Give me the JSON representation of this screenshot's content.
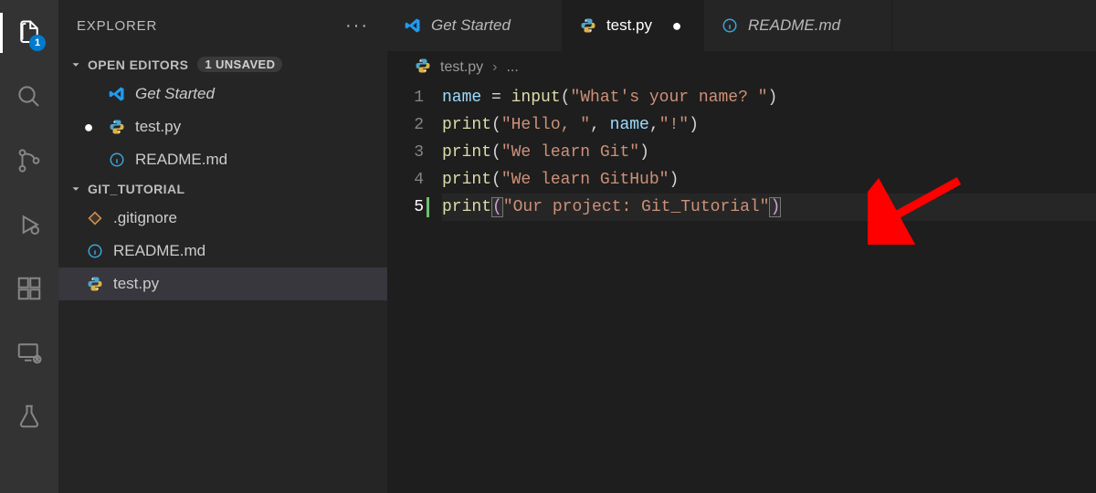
{
  "activity_bar": {
    "explorer_badge": "1"
  },
  "sidebar": {
    "title": "EXPLORER",
    "sections": {
      "open_editors": {
        "label": "OPEN EDITORS",
        "unsaved_label": "1 UNSAVED",
        "items": [
          {
            "label": "Get Started",
            "icon": "vscode",
            "italic": true,
            "modified": false
          },
          {
            "label": "test.py",
            "icon": "python",
            "italic": false,
            "modified": true
          },
          {
            "label": "README.md",
            "icon": "info",
            "italic": false,
            "modified": false
          }
        ]
      },
      "folder": {
        "label": "GIT_TUTORIAL",
        "items": [
          {
            "label": ".gitignore",
            "icon": "git",
            "selected": false
          },
          {
            "label": "README.md",
            "icon": "info",
            "selected": false
          },
          {
            "label": "test.py",
            "icon": "python",
            "selected": true
          }
        ]
      }
    }
  },
  "tabs": [
    {
      "label": "Get Started",
      "icon": "vscode",
      "active": false,
      "italic": true,
      "modified": false
    },
    {
      "label": "test.py",
      "icon": "python",
      "active": true,
      "italic": false,
      "modified": true
    },
    {
      "label": "README.md",
      "icon": "info",
      "active": false,
      "italic": false,
      "modified": false
    }
  ],
  "breadcrumb": {
    "file_icon": "python",
    "file": "test.py",
    "rest": "..."
  },
  "code": {
    "active_line": 5,
    "lines": [
      [
        {
          "c": "tk-var",
          "t": "name"
        },
        {
          "c": "tk-op",
          "t": " = "
        },
        {
          "c": "tk-func",
          "t": "input"
        },
        {
          "c": "tk-paren",
          "t": "("
        },
        {
          "c": "tk-str",
          "t": "\"What's your name? \""
        },
        {
          "c": "tk-paren",
          "t": ")"
        }
      ],
      [
        {
          "c": "tk-func",
          "t": "print"
        },
        {
          "c": "tk-paren",
          "t": "("
        },
        {
          "c": "tk-str",
          "t": "\"Hello, \""
        },
        {
          "c": "tk-punct",
          "t": ", "
        },
        {
          "c": "tk-var",
          "t": "name"
        },
        {
          "c": "tk-punct",
          "t": ","
        },
        {
          "c": "tk-str",
          "t": "\"!\""
        },
        {
          "c": "tk-paren",
          "t": ")"
        }
      ],
      [
        {
          "c": "tk-func",
          "t": "print"
        },
        {
          "c": "tk-paren",
          "t": "("
        },
        {
          "c": "tk-str",
          "t": "\"We learn Git\""
        },
        {
          "c": "tk-paren",
          "t": ")"
        }
      ],
      [
        {
          "c": "tk-func",
          "t": "print"
        },
        {
          "c": "tk-paren",
          "t": "("
        },
        {
          "c": "tk-str",
          "t": "\"We learn GitHub\""
        },
        {
          "c": "tk-paren",
          "t": ")"
        }
      ],
      [
        {
          "c": "tk-func",
          "t": "print"
        },
        {
          "c": "tk-bracket",
          "t": "("
        },
        {
          "c": "tk-str",
          "t": "\"Our project: Git_Tutorial\""
        },
        {
          "c": "tk-bracket",
          "t": ")"
        }
      ]
    ]
  }
}
